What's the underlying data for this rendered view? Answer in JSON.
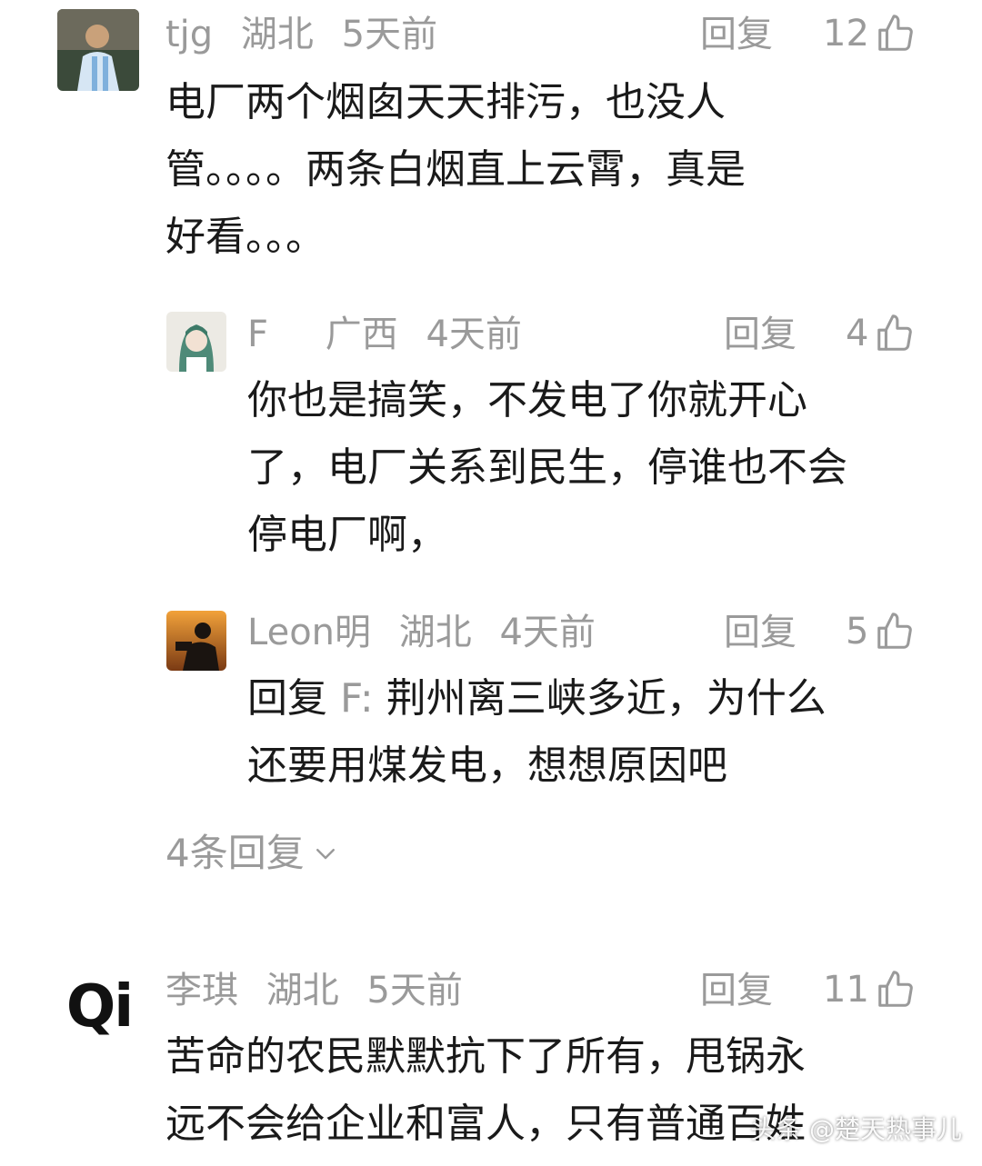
{
  "comments": [
    {
      "user": "tjg",
      "location": "湖北",
      "time": "5天前",
      "reply_label": "回复",
      "likes": "12",
      "text": "电厂两个烟囱天天排污，也没人\n管。。。。两条白烟直上云霄，真是\n好看。。。"
    },
    {
      "user": "F",
      "location": "广西",
      "time": "4天前",
      "reply_label": "回复",
      "likes": "4",
      "text": "你也是搞笑，不发电了你就开心\n了，电厂关系到民生，停谁也不会\n停电厂啊，"
    },
    {
      "user": "Leon明",
      "location": "湖北",
      "time": "4天前",
      "reply_label": "回复",
      "likes": "5",
      "text_prefix": "回复 ",
      "mention": "F:",
      "text": " 荆州离三峡多近，为什么\n还要用煤发电，想想原因吧"
    },
    {
      "user": "李琪",
      "location": "湖北",
      "time": "5天前",
      "reply_label": "回复",
      "likes": "11",
      "text": "苦命的农民默默抗下了所有，甩锅永\n远不会给企业和富人，只有普通百姓"
    }
  ],
  "more_replies": "4条回复",
  "avatar_logo_text": "Qi",
  "watermark": "头条 @楚天热事儿",
  "colors": {
    "meta": "#9a9a9a",
    "text": "#1a1a1a",
    "background": "#ffffff"
  }
}
